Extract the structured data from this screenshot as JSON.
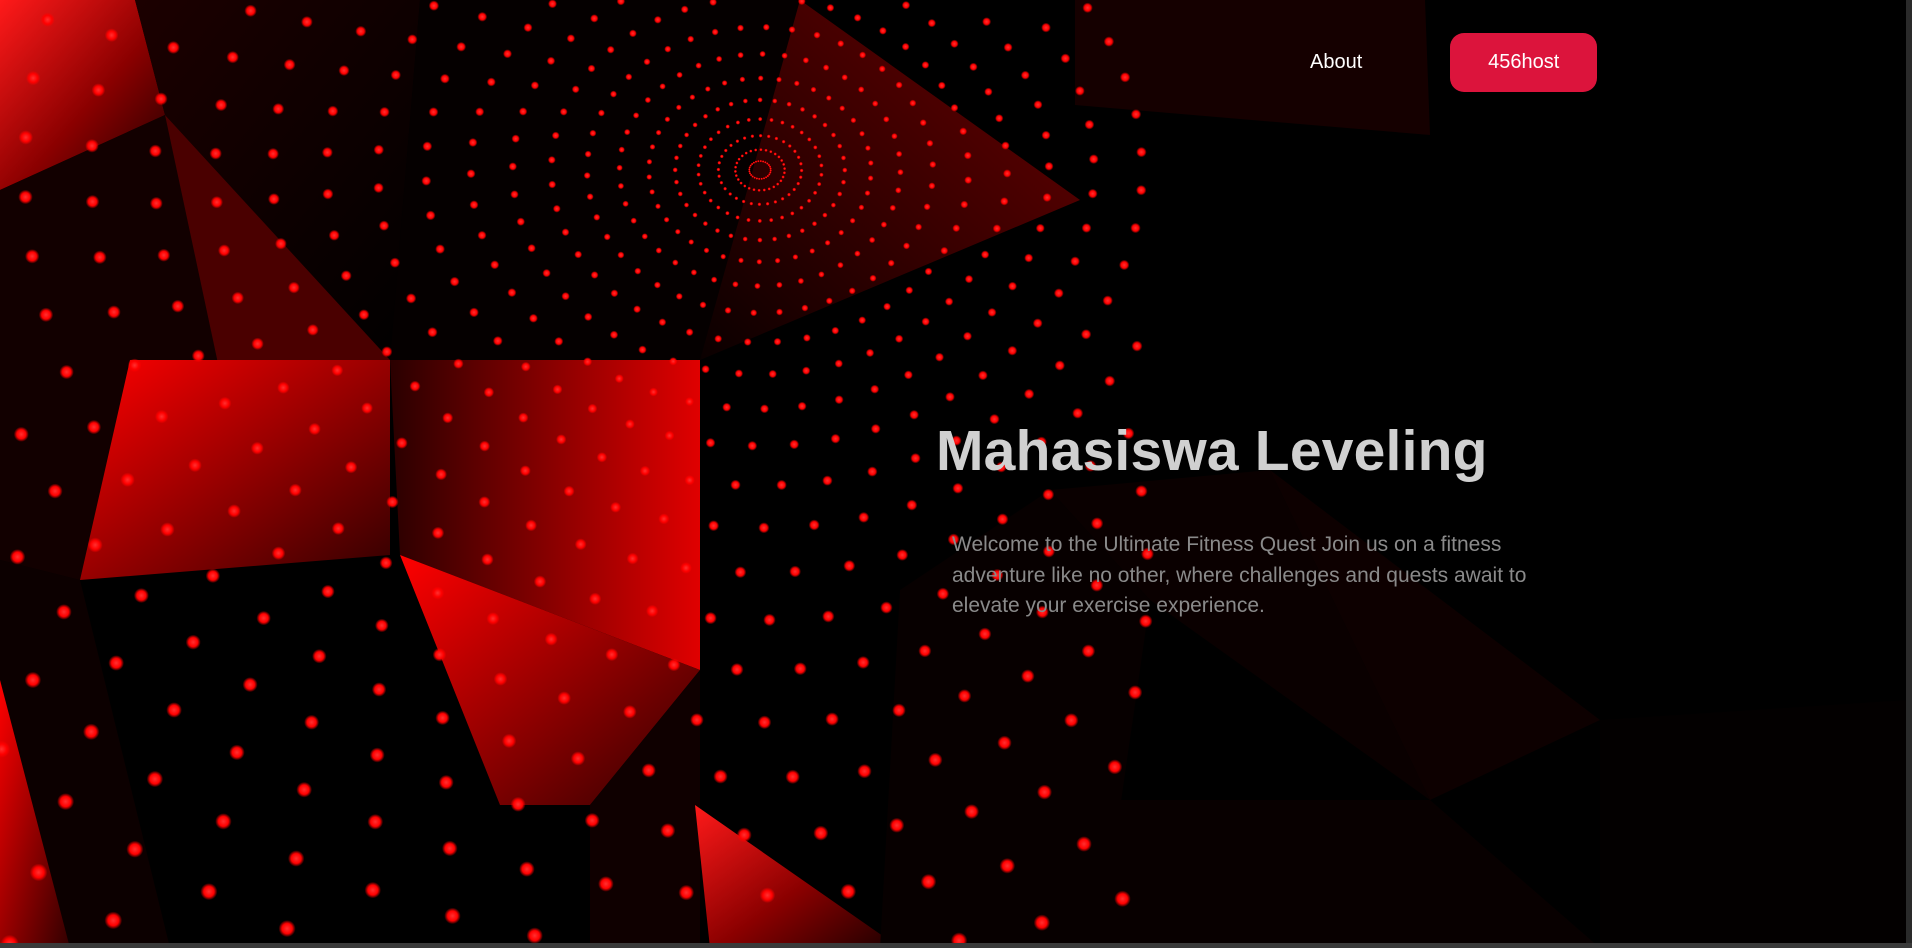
{
  "nav": {
    "about_label": "About",
    "cta_label": "456host"
  },
  "hero": {
    "title": "Mahasiswa Leveling",
    "description": "Welcome to the Ultimate Fitness Quest Join us on a fitness adventure like no other, where challenges and quests await to elevate your exercise experience."
  },
  "colors": {
    "background": "#000000",
    "accent": "#dc143c",
    "dot_red": "#ff1010",
    "title_text": "#d0d0d0",
    "body_text": "#8a8a8a"
  }
}
